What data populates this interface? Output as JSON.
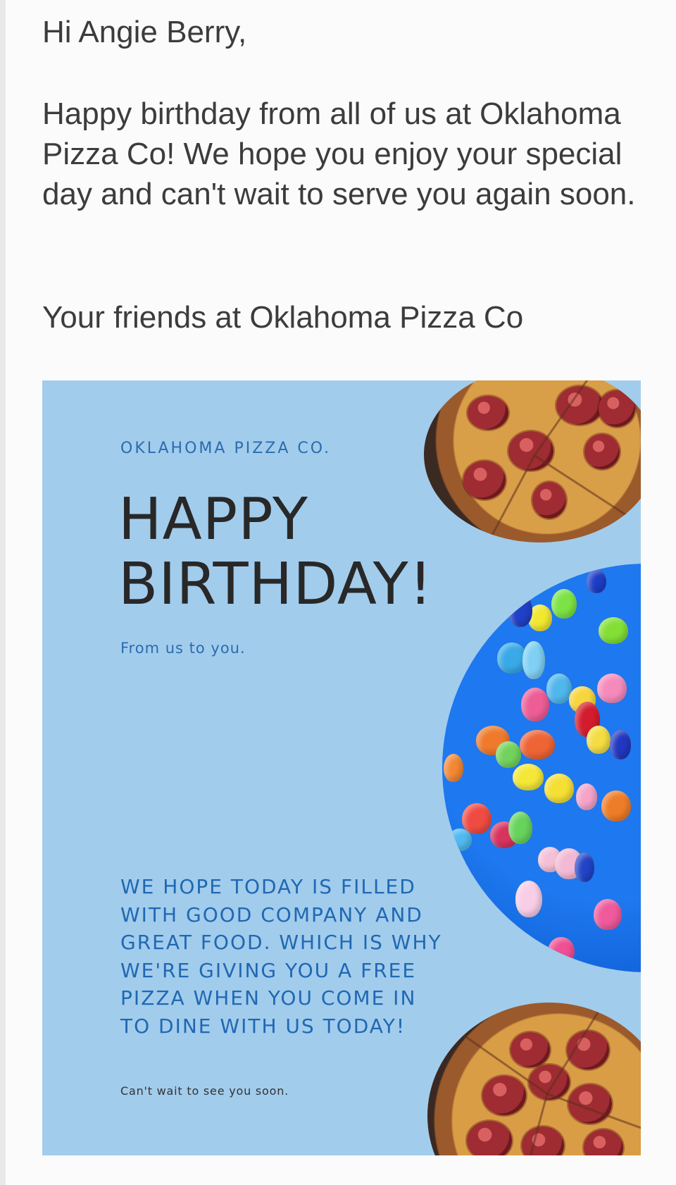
{
  "email": {
    "greeting": "Hi Angie Berry,",
    "message": "Happy birthday from all of us at Oklahoma Pizza Co! We hope you enjoy your special day and can't wait to serve you again soon.",
    "signoff": "Your friends at Oklahoma Pizza Co"
  },
  "card": {
    "brand": "OKLAHOMA PIZZA CO.",
    "headline_line1": "HAPPY",
    "headline_line2": "BIRTHDAY!",
    "from": "From us to you.",
    "offer": "WE HOPE TODAY IS FILLED WITH GOOD COMPANY AND GREAT FOOD. WHICH IS WHY WE'RE GIVING YOU A FREE PIZZA WHEN YOU COME IN TO DINE WITH US TODAY!",
    "closing": "Can't wait to see you soon.",
    "background_color": "#A2CCEC",
    "accent_color": "#1F68B3",
    "images": {
      "top": "pizza-image",
      "middle": "balloons-image",
      "bottom": "pizza-image"
    }
  }
}
